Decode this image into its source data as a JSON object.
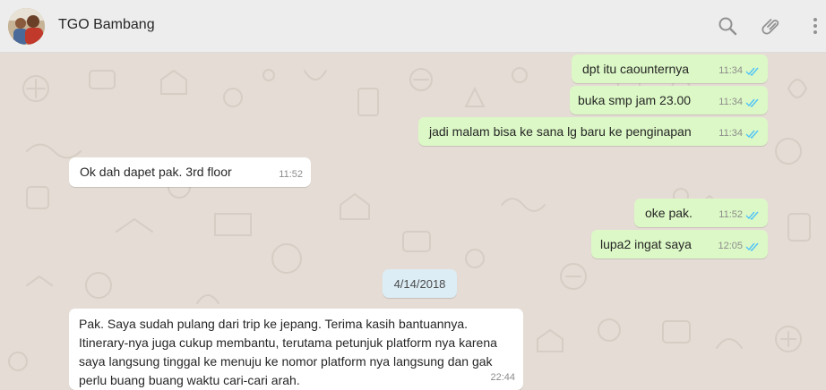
{
  "header": {
    "contact_name": "TGO Bambang",
    "icons": [
      "search-icon",
      "attach-icon",
      "menu-icon"
    ]
  },
  "colors": {
    "outgoing_bubble": "#dcf8c6",
    "incoming_bubble": "#ffffff",
    "chat_background": "#e5ddd5",
    "header_background": "#ededed",
    "read_ticks": "#4fc3f7",
    "date_chip": "#dcedf6"
  },
  "messages": [
    {
      "direction": "out",
      "text": "dpt itu caounternya",
      "time": "11:34",
      "status": "read"
    },
    {
      "direction": "out",
      "text": "buka smp jam 23.00",
      "time": "11:34",
      "status": "read"
    },
    {
      "direction": "out",
      "text": "jadi malam bisa ke sana lg baru ke penginapan",
      "time": "11:34",
      "status": "read"
    },
    {
      "direction": "in",
      "text": "Ok dah dapet pak. 3rd floor",
      "time": "11:52"
    },
    {
      "direction": "out",
      "text": "oke pak.",
      "time": "11:52",
      "status": "read"
    },
    {
      "direction": "out",
      "text": "lupa2 ingat saya",
      "time": "12:05",
      "status": "read"
    },
    {
      "direction": "in",
      "text": "Pak. Saya sudah pulang dari trip ke jepang. Terima kasih bantuannya.\nItinerary-nya juga cukup membantu, terutama petunjuk platform nya karena\nsaya langsung tinggal ke menuju ke nomor platform nya langsung dan gak\nperlu buang buang waktu cari-cari arah.",
      "time": "22:44"
    }
  ],
  "date_separator": "4/14/2018"
}
